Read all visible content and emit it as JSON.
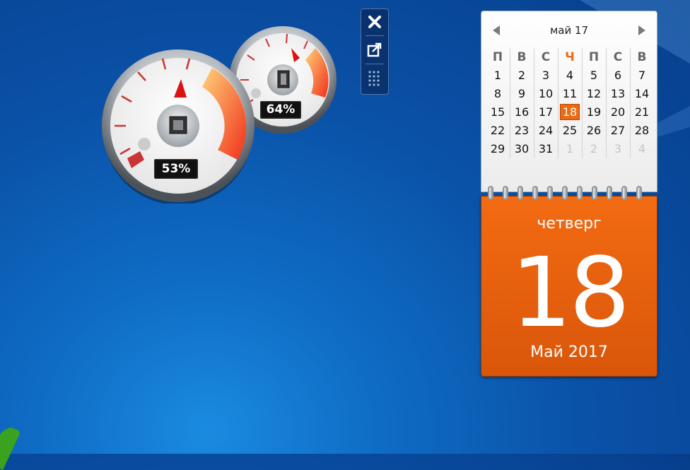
{
  "desktop": {
    "accent": "#0a52a8"
  },
  "toolbar": {
    "close_icon": "close-icon",
    "options_icon": "options-icon",
    "drag_icon": "drag-handle-icon"
  },
  "gauges": {
    "cpu": {
      "label": "53%",
      "icon": "cpu-chip-icon",
      "value": 53
    },
    "memory": {
      "label": "64%",
      "icon": "memory-chip-icon",
      "value": 64
    }
  },
  "calendar": {
    "header": "май 17",
    "weekdays": [
      "П",
      "В",
      "С",
      "Ч",
      "П",
      "С",
      "В"
    ],
    "today_col": 3,
    "weeks": [
      [
        "1",
        "2",
        "3",
        "4",
        "5",
        "6",
        "7"
      ],
      [
        "8",
        "9",
        "10",
        "11",
        "12",
        "13",
        "14"
      ],
      [
        "15",
        "16",
        "17",
        "18",
        "19",
        "20",
        "21"
      ],
      [
        "22",
        "23",
        "24",
        "25",
        "26",
        "27",
        "28"
      ],
      [
        "29",
        "30",
        "31",
        "1",
        "2",
        "3",
        "4"
      ]
    ],
    "today": "18",
    "weekday_name": "четверг",
    "day": "18",
    "month_year": "Май 2017",
    "accent": "#ec6a11"
  }
}
